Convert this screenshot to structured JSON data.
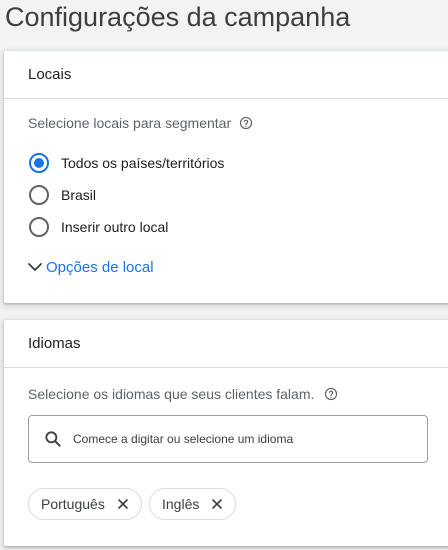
{
  "page": {
    "title": "Configurações da campanha"
  },
  "locations": {
    "header": "Locais",
    "helper_text": "Selecione locais para segmentar",
    "options": [
      {
        "label": "Todos os países/territórios",
        "selected": true
      },
      {
        "label": "Brasil",
        "selected": false
      },
      {
        "label": "Inserir outro local",
        "selected": false
      }
    ],
    "more_options_label": "Opções de local"
  },
  "languages": {
    "header": "Idiomas",
    "helper_text": "Selecione os idiomas que seus clientes falam.",
    "search_placeholder": "Comece a digitar ou selecione um idioma",
    "selected": [
      {
        "label": "Português"
      },
      {
        "label": "Inglês"
      }
    ]
  },
  "colors": {
    "accent": "#1a73e8",
    "text": "#202124",
    "muted": "#5f6368",
    "divider": "#dadce0"
  },
  "icons": [
    "help-icon",
    "chevron-down-icon",
    "search-icon",
    "close-icon"
  ]
}
